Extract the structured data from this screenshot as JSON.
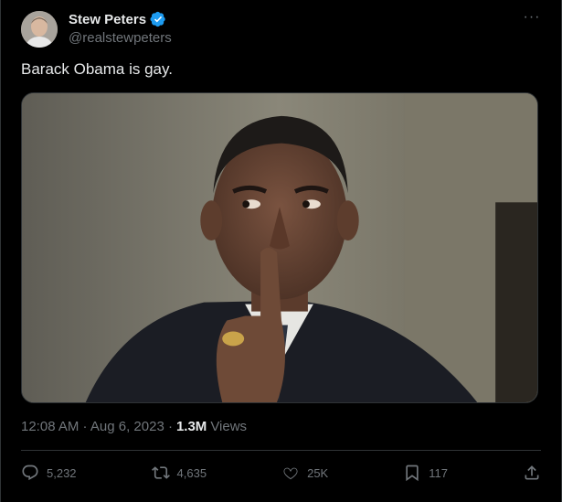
{
  "author": {
    "display_name": "Stew Peters",
    "handle": "@realstewpeters",
    "verified_icon": "verified-badge-icon"
  },
  "tweet": {
    "text": "Barack Obama is gay."
  },
  "meta": {
    "timestamp": "12:08 AM · Aug 6, 2023 ·",
    "views_count": "1.3M",
    "views_label": "Views"
  },
  "actions": {
    "replies": "5,232",
    "reposts": "4,635",
    "likes": "25K",
    "bookmarks": "117"
  },
  "colors": {
    "background": "#000000",
    "text": "#e7e9ea",
    "muted": "#71767b",
    "verified": "#1d9bf0"
  }
}
